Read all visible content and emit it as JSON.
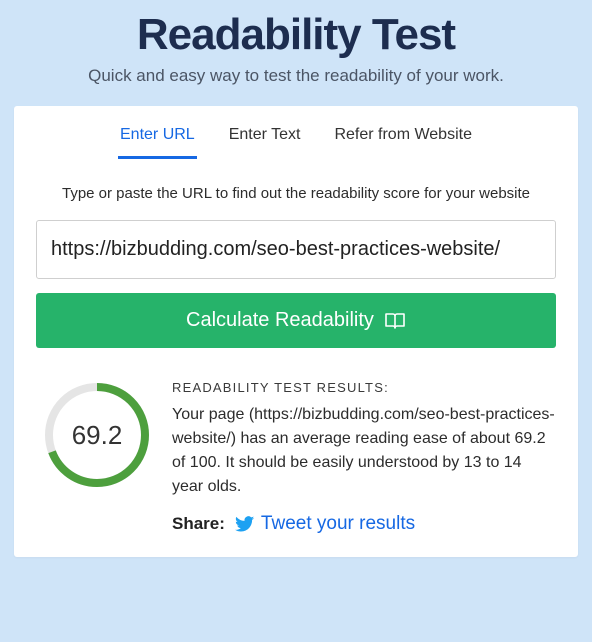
{
  "header": {
    "title": "Readability Test",
    "subtitle": "Quick and easy way to test the readability of your work."
  },
  "tabs": {
    "items": [
      {
        "label": "Enter URL",
        "active": true
      },
      {
        "label": "Enter Text",
        "active": false
      },
      {
        "label": "Refer from Website",
        "active": false
      }
    ]
  },
  "form": {
    "instruction": "Type or paste the URL to find out the readability score for your website",
    "url_value": "https://bizbudding.com/seo-best-practices-website/",
    "calculate_label": "Calculate Readability"
  },
  "results": {
    "score": "69.2",
    "score_percent": 69.2,
    "label": "READABILITY TEST RESULTS:",
    "body": "Your page (https://bizbudding.com/seo-best-practices-website/) has an average reading ease of about 69.2 of 100. It should be easily understood by 13 to 14 year olds.",
    "share_label": "Share:",
    "tweet_label": "Tweet your results"
  },
  "colors": {
    "accent_blue": "#1668e3",
    "button_green": "#26b36a",
    "gauge_green": "#4d9f3d",
    "gauge_track": "#e5e5e5"
  }
}
